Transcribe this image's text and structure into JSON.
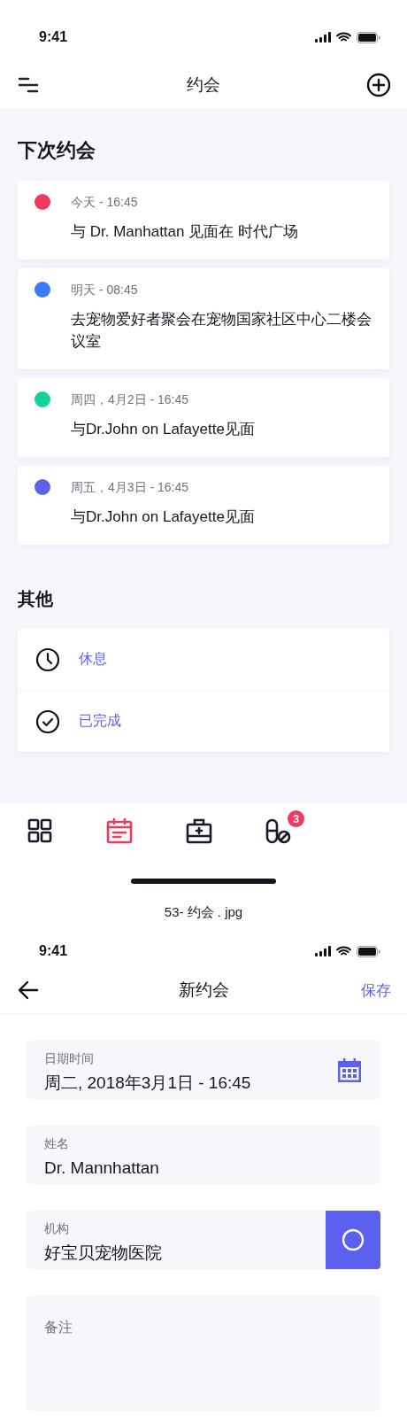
{
  "screen_1": {
    "status_bar": {
      "time": "9:41"
    },
    "nav": {
      "title": "约会"
    },
    "upcoming": {
      "heading": "下次约会",
      "appointments": [
        {
          "when": "今天 - 16:45",
          "title": "与 Dr. Manhattan 见面在 时代广场",
          "color": "#f23a5f"
        },
        {
          "when": "明天 - 08:45",
          "title": "去宠物爱好者聚会在宠物国家社区中心二楼会议室",
          "color": "#3c7cf6"
        },
        {
          "when": "周四，4月2日 - 16:45",
          "title": "与Dr.John on Lafayette见面",
          "color": "#13d29b"
        },
        {
          "when": "周五，4月3日 - 16:45",
          "title": "与Dr.John on Lafayette见面",
          "color": "#5e60ee"
        }
      ]
    },
    "other": {
      "heading": "其他",
      "items": [
        {
          "kind": "clock",
          "label": "休息"
        },
        {
          "kind": "check",
          "label": "已完成"
        }
      ]
    },
    "tab_bar": [
      {
        "kind": "grid",
        "selected": false
      },
      {
        "kind": "calendar",
        "selected": true
      },
      {
        "kind": "medkit",
        "selected": false
      },
      {
        "kind": "pills",
        "selected": false,
        "badge": "3"
      }
    ]
  },
  "caption": "53- 约会 . jpg",
  "screen_2": {
    "status_bar": {
      "time": "9:41"
    },
    "nav": {
      "title": "新约会",
      "action": "保存"
    },
    "fields": [
      {
        "kind": "date",
        "label": "日期时间",
        "value": "周二, 2018年3月1日 - 16:45"
      },
      {
        "kind": "text",
        "label": "姓名",
        "value": "Dr. Mannhattan"
      },
      {
        "kind": "picker",
        "label": "机构",
        "value": "好宝贝宠物医院"
      },
      {
        "kind": "notes",
        "placeholder": "备注"
      }
    ]
  }
}
